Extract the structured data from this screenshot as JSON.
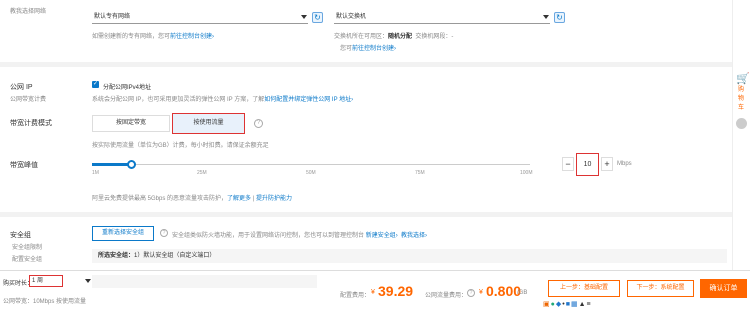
{
  "network": {
    "label": "教我选择网络",
    "vpc_select": "默认专有网络",
    "vpc_hint": "如需创建新的专有网络，您可",
    "vpc_hint_link": "前往控制台创建›",
    "vswitch_select": "默认交换机",
    "zone_label": "交换机所在可用区：",
    "zone_value": "随机分配",
    "available_ip_label": "交换机网段：",
    "available_ip_value": "-",
    "vswitch_hint": "您可",
    "vswitch_hint_link": "前往控制台创建›"
  },
  "public_ip": {
    "label": "公网 IP",
    "sublabel": "公网带宽计费",
    "checkbox_label": "分配公网IPv4地址",
    "desc": "系统会分配公网 IP，也可采用更加灵活的弹性公网 IP 方案，了解",
    "desc_link": "如何配置并绑定弹性公网 IP 地址›"
  },
  "billing": {
    "label": "带宽计费模式",
    "option1": "按固定带宽",
    "option2": "按使用流量",
    "desc": "按实际使用流量（单位为GB）计费，每小时扣费。请保证余额充足"
  },
  "bandwidth": {
    "label": "带宽峰值",
    "ticks": [
      "1M",
      "25M",
      "50M",
      "75M",
      "100M"
    ],
    "value": "10",
    "unit": "Mbps",
    "desc": "阿里云免费提供最高 5Gbps 的恶意流量攻击防护，",
    "desc_link1": "了解更多",
    "desc_sep": " | ",
    "desc_link2": "提升防护能力",
    "slider_fraction": 0.09
  },
  "security": {
    "label": "安全组",
    "sub1": "安全组限制",
    "sub2": "配置安全组",
    "button": "重新选择安全组",
    "desc": "安全组类似防火墙功能，用于设置网络访问控制，您也可以到管理控制台",
    "desc_link1": "新建安全组›",
    "desc_link2": "教我选择›",
    "selected_label": "所选安全组：",
    "selected_value": "1）默认安全组（自定义端口）"
  },
  "footer": {
    "duration_label": "购买时长：",
    "duration_value": "1 周",
    "bandwidth_summary": "公网带宽：10Mbps 按使用流量",
    "config_fee_label": "配置费用：",
    "config_fee_currency": "¥",
    "config_fee_value": "39.29",
    "traffic_fee_label": "公网流量费用：",
    "traffic_fee_currency": "¥",
    "traffic_fee_value": "0.800",
    "traffic_fee_unit": "/GB",
    "prev_button": "上一步：基础配置",
    "next_button": "下一步：系统配置",
    "confirm_button": "确认订单"
  },
  "sidebar": {
    "cart_label": "购物车"
  }
}
